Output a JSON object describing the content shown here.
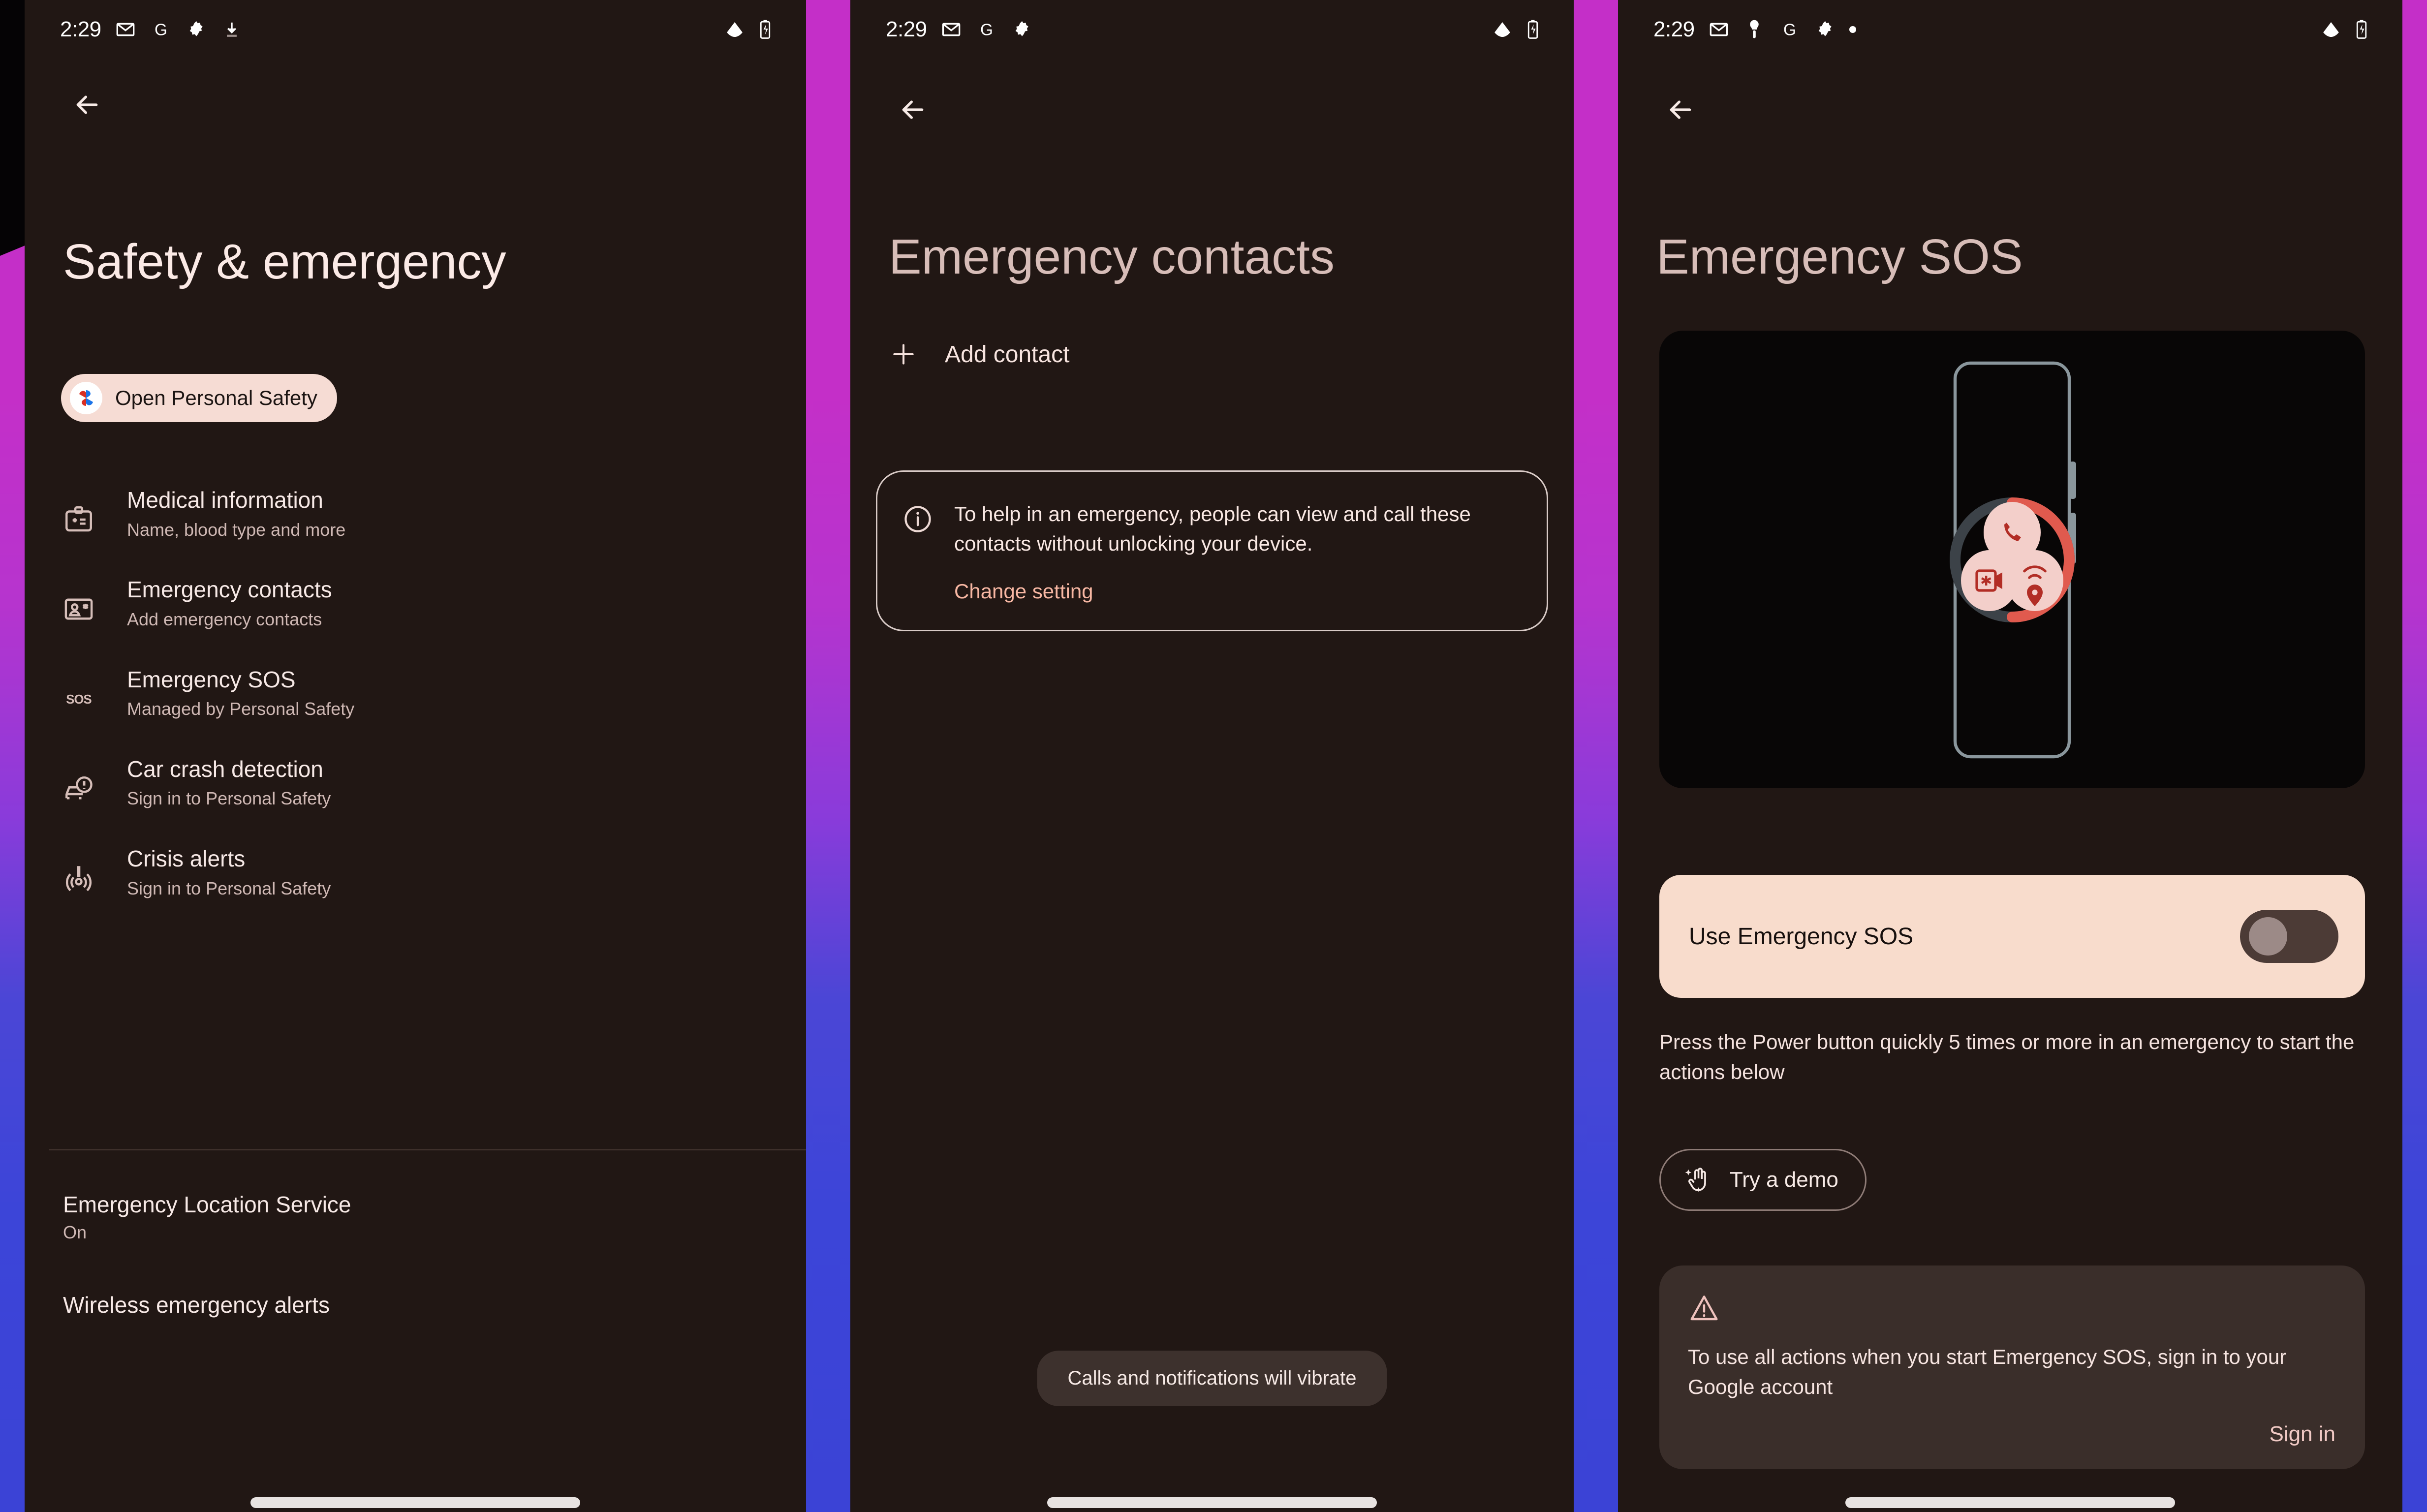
{
  "wallpaper": {
    "gradient_from": "#C42FC8",
    "gradient_to": "#3B43D6"
  },
  "theme": {
    "surface": "#211714",
    "on_surface": "#F7E9E6",
    "on_surface_variant": "#CFB8B4",
    "accent_pink": "#F6DCD4",
    "accent_salmon": "#F7B7A3",
    "title_muted": "#D7BDB8",
    "toast_surface": "#3D312D",
    "warn_surface": "#3A2E2A"
  },
  "panel1": {
    "statusbar": {
      "time": "2:29",
      "icons": [
        "gmail-icon",
        "google-icon",
        "gear-icon",
        "download-icon"
      ],
      "right_icons": [
        "wifi-icon",
        "battery-charging-icon"
      ]
    },
    "back_label": "Back",
    "title": "Safety & emergency",
    "chip": {
      "label": "Open Personal Safety",
      "icon": "personal-safety-app-icon"
    },
    "items": [
      {
        "icon": "medical-badge-icon",
        "title": "Medical information",
        "subtitle": "Name, blood type and more"
      },
      {
        "icon": "contact-card-icon",
        "title": "Emergency contacts",
        "subtitle": "Add emergency contacts"
      },
      {
        "icon": "sos-icon",
        "title": "Emergency SOS",
        "subtitle": "Managed by Personal Safety"
      },
      {
        "icon": "car-crash-icon",
        "title": "Car crash detection",
        "subtitle": "Sign in to Personal Safety"
      },
      {
        "icon": "crisis-alert-icon",
        "title": "Crisis alerts",
        "subtitle": "Sign in to Personal Safety"
      }
    ],
    "plain_items": [
      {
        "title": "Emergency Location Service",
        "subtitle": "On"
      },
      {
        "title": "Wireless emergency alerts",
        "subtitle": ""
      }
    ]
  },
  "panel2": {
    "statusbar": {
      "time": "2:29",
      "icons": [
        "gmail-icon",
        "google-icon",
        "gear-icon"
      ],
      "right_icons": [
        "wifi-icon",
        "battery-charging-icon"
      ]
    },
    "back_label": "Back",
    "title": "Emergency contacts",
    "add_contact_label": "Add contact",
    "info_card": {
      "icon": "info-icon",
      "text": "To help in an emergency, people can view and call these contacts without unlocking your device.",
      "link": "Change setting"
    },
    "toast": "Calls and notifications will vibrate"
  },
  "panel3": {
    "statusbar": {
      "time": "2:29",
      "icons": [
        "gmail-icon",
        "flashlight-icon",
        "google-icon",
        "gear-icon",
        "dot-icon"
      ],
      "right_icons": [
        "wifi-icon",
        "battery-charging-icon"
      ]
    },
    "back_label": "Back",
    "title": "Emergency SOS",
    "hero": {
      "name": "emergency-sos-illustration",
      "ring_progress_color": "#E05A4E",
      "ring_track_color": "#3C4248",
      "action_icons": [
        "call-icon",
        "emergency-video-icon",
        "location-share-icon"
      ]
    },
    "toggle": {
      "label": "Use Emergency SOS",
      "state": "off"
    },
    "hint": "Press the Power button quickly 5 times or more in an emergency to start the actions below",
    "demo_button": {
      "label": "Try a demo",
      "icon": "tap-gesture-icon"
    },
    "warning_card": {
      "icon": "warning-triangle-icon",
      "text": "To use all actions when you start Emergency SOS, sign in to your Google account",
      "link": "Sign in"
    }
  }
}
